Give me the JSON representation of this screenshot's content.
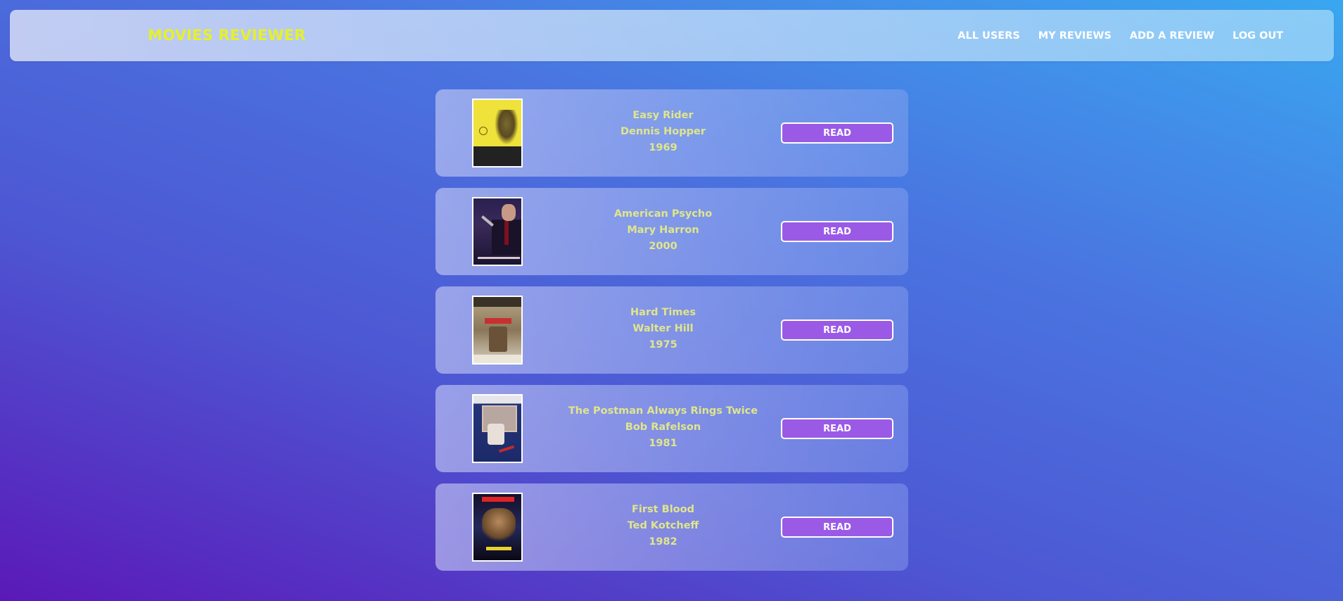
{
  "brand": "MOVIES REVIEWER",
  "nav": {
    "items": [
      {
        "label": "ALL USERS"
      },
      {
        "label": "MY REVIEWS"
      },
      {
        "label": "ADD A REVIEW"
      },
      {
        "label": "LOG OUT"
      }
    ]
  },
  "movies": [
    {
      "title": "Easy Rider",
      "director": "Dennis Hopper",
      "year": "1969",
      "button": "READ"
    },
    {
      "title": "American Psycho",
      "director": "Mary Harron",
      "year": "2000",
      "button": "READ"
    },
    {
      "title": "Hard Times",
      "director": "Walter Hill",
      "year": "1975",
      "button": "READ"
    },
    {
      "title": "The Postman Always Rings Twice",
      "director": "Bob Rafelson",
      "year": "1981",
      "button": "READ"
    },
    {
      "title": "First Blood",
      "director": "Ted Kotcheff",
      "year": "1982",
      "button": "READ"
    }
  ],
  "colors": {
    "brand": "#e6f02a",
    "card_text": "#e0e68a",
    "button_bg": "#9a5ae6",
    "button_text": "#ffffff"
  }
}
